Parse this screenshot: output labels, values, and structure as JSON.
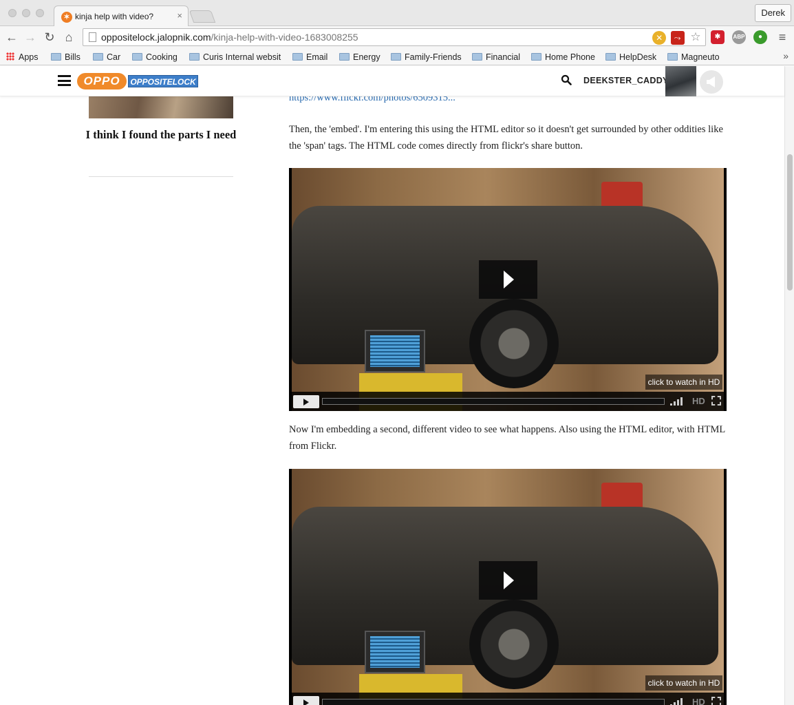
{
  "browser": {
    "tab_title": "kinja help with video?",
    "profile_name": "Derek",
    "url_host": "oppositelock.jalopnik.com",
    "url_path": "/kinja-help-with-video-1683008255",
    "bookmarks": [
      "Apps",
      "Bills",
      "Car",
      "Cooking",
      "Curis Internal websit",
      "Email",
      "Energy",
      "Family-Friends",
      "Financial",
      "Home Phone",
      "HelpDesk",
      "Magneuto"
    ],
    "bookmarks_more": "»",
    "extensions": [
      "ABP"
    ]
  },
  "site": {
    "logo_oppo": "OPPO",
    "logo_word": "OPPOSITELOCK",
    "username": "DEEKSTER_CADDY"
  },
  "sidebar": {
    "title": "I think I found the parts I need"
  },
  "article": {
    "link_text": "https://www.flickr.com/photos/6509315...",
    "para1": "Then, the 'embed'. I'm entering this using the HTML editor so it doesn't get surrounded by other oddities like the 'span' tags. The HTML code comes directly from flickr's share button.",
    "para2": "Now I'm embedding a second, different video to see what happens. Also using the HTML editor, with HTML from Flickr."
  },
  "video": {
    "hd_prompt": "click to watch in HD",
    "hd_badge": "HD"
  }
}
